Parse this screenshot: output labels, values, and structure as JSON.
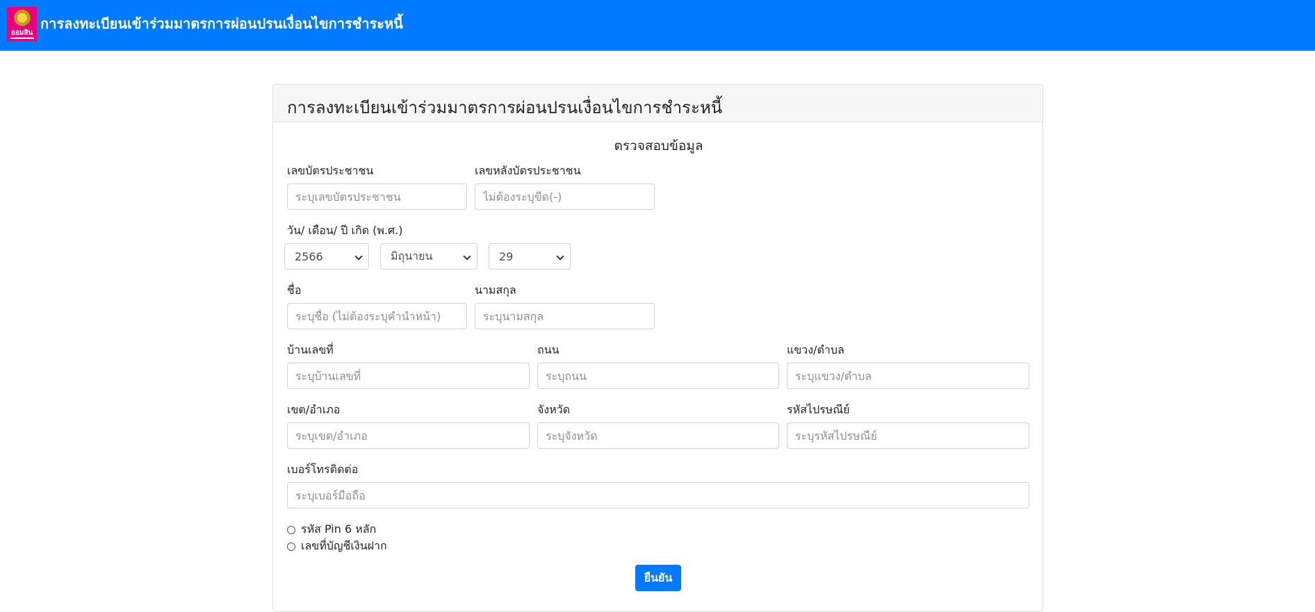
{
  "navbar": {
    "brand": "การลงทะเบียนเข้าร่วมมาตรการผ่อนปรนเงื่อนไขการชำระหนี้",
    "logo_text": "ออมสิน",
    "brand_color": "#007bff",
    "logo_color": "#e6007e"
  },
  "card": {
    "title": "การลงทะเบียนเข้าร่วมมาตรการผ่อนปรนเงื่อนไขการชำระหนี้",
    "section_title": "ตรวจสอบข้อมูล"
  },
  "form": {
    "id_card": {
      "label": "เลขบัตรประชาชน",
      "placeholder": "ระบุเลขบัตรประชาชน",
      "value": ""
    },
    "laser_code": {
      "label": "เลขหลังบัตรประชาชน",
      "placeholder": "ไม่ต้องระบุขีด(-)",
      "value": ""
    },
    "birthdate": {
      "label": "วัน/ เดือน/ ปี เกิด (พ.ศ.)",
      "year": "2566",
      "month": "มิถุนายน",
      "day": "29"
    },
    "first_name": {
      "label": "ชื่อ",
      "placeholder": "ระบุชื่อ (ไม่ต้องระบุคำนำหน้า)",
      "value": ""
    },
    "last_name": {
      "label": "นามสกุล",
      "placeholder": "ระบุนามสกุล",
      "value": ""
    },
    "house_no": {
      "label": "บ้านเลขที่",
      "placeholder": "ระบุบ้านเลขที่",
      "value": ""
    },
    "road": {
      "label": "ถนน",
      "placeholder": "ระบุถนน",
      "value": ""
    },
    "subdistrict": {
      "label": "แขวง/ตำบล",
      "placeholder": "ระบุแขวง/ตำบล",
      "value": ""
    },
    "district": {
      "label": "เขต/อำเภอ",
      "placeholder": "ระบุเขต/อำเภอ",
      "value": ""
    },
    "province": {
      "label": "จังหวัด",
      "placeholder": "ระบุจังหวัด",
      "value": ""
    },
    "postcode": {
      "label": "รหัสไปรษณีย์",
      "placeholder": "ระบุรหัสไปรษณีย์",
      "value": ""
    },
    "phone": {
      "label": "เบอร์โทรติดต่อ",
      "placeholder": "ระบุเบอร์มือถือ",
      "value": ""
    },
    "radio_options": [
      "รหัส Pin 6 หลัก",
      "เลขที่บัญชีเงินฝาก"
    ],
    "submit_label": "ยืนยัน"
  }
}
